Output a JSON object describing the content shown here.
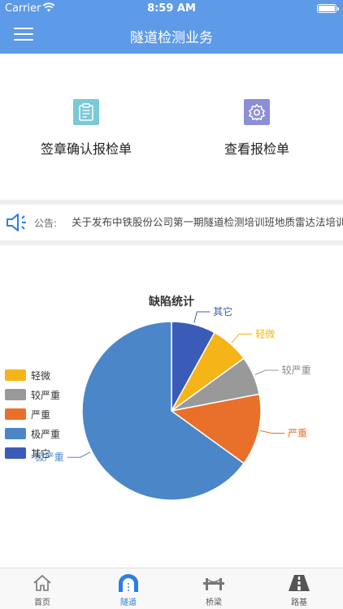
{
  "status_bar": {
    "carrier": "Carrier",
    "time": "8:59 AM"
  },
  "navbar": {
    "title": "隧道检测业务",
    "menu_icon": "hamburger-menu-icon"
  },
  "actions": [
    {
      "label": "签章确认报检单",
      "icon": "clipboard-icon",
      "color": "#7bc8d8"
    },
    {
      "label": "查看报检单",
      "icon": "gear-icon",
      "color": "#8b8fd8"
    }
  ],
  "notice": {
    "tag": "公告:",
    "text": "关于发布中铁股份公司第一期隧道检测培训班地质雷达法培训",
    "icon": "speaker-icon"
  },
  "chart_data": {
    "type": "pie",
    "title": "缺陷统计",
    "slices": [
      {
        "name": "其它",
        "value": 8,
        "color": "#3a5bb8"
      },
      {
        "name": "轻微",
        "value": 7,
        "color": "#f5b418"
      },
      {
        "name": "较严重",
        "value": 7,
        "color": "#999999"
      },
      {
        "name": "严重",
        "value": 13,
        "color": "#e8702a"
      },
      {
        "name": "极严重",
        "value": 65,
        "color": "#4a86c8"
      }
    ],
    "legend": [
      "轻微",
      "较严重",
      "严重",
      "极严重",
      "其它"
    ],
    "legend_position": "left"
  },
  "tabbar": [
    {
      "label": "首页",
      "icon": "home-icon",
      "active": false
    },
    {
      "label": "隧道",
      "icon": "tunnel-icon",
      "active": true
    },
    {
      "label": "桥梁",
      "icon": "bridge-icon",
      "active": false
    },
    {
      "label": "路基",
      "icon": "road-icon",
      "active": false
    }
  ]
}
